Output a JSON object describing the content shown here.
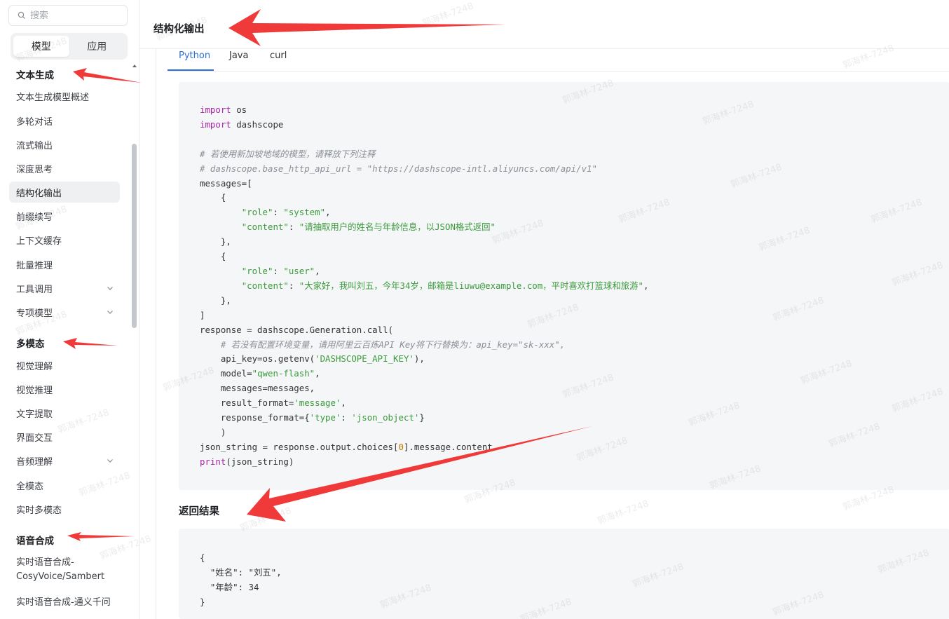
{
  "sidebar": {
    "search_placeholder": "搜索",
    "seg_tabs": [
      "模型",
      "应用"
    ],
    "sections": {
      "text_gen": "文本生成",
      "multimodal": "多模态",
      "speech": "语音合成"
    },
    "items_text": [
      "文本生成模型概述",
      "多轮对话",
      "流式输出",
      "深度思考",
      "结构化输出",
      "前缀续写",
      "上下文缓存",
      "批量推理",
      "工具调用",
      "专项模型"
    ],
    "items_mm": [
      "视觉理解",
      "视觉推理",
      "文字提取",
      "界面交互",
      "音频理解",
      "全模态",
      "实时多模态"
    ],
    "items_speech": [
      "实时语音合成-",
      "CosyVoice/Sambert",
      "实时语音合成-通义千问"
    ]
  },
  "content": {
    "title": "结构化输出",
    "tabs": [
      "Python",
      "Java",
      "curl"
    ],
    "result_title": "返回结果"
  },
  "code": {
    "l1": "import",
    "l1b": " os",
    "l2": "import",
    "l2b": " dashscope",
    "c1": "# 若使用新加坡地域的模型，请释放下列注释",
    "c2": "# dashscope.base_http_api_url = \"https://dashscope-intl.aliyuncs.com/api/v1\"",
    "l5": "messages=[",
    "l6": "    {",
    "l7k": "\"role\"",
    "l7v": "\"system\"",
    "l8k": "\"content\"",
    "l8v": "\"请抽取用户的姓名与年龄信息，以JSON格式返回\"",
    "l9": "    },",
    "l10": "    {",
    "l11k": "\"role\"",
    "l11v": "\"user\"",
    "l12k": "\"content\"",
    "l12v": "\"大家好，我叫刘五，今年34岁，邮箱是liuwu@example.com，平时喜欢打篮球和旅游\"",
    "l13": "    },",
    "l14": "]",
    "l15": "response = dashscope.Generation.call(",
    "c3": "    # 若没有配置环境变量，请用阿里云百炼API Key将下行替换为：api_key=\"sk-xxx\",",
    "l17a": "    api_key=os.getenv(",
    "l17s": "'DASHSCOPE_API_KEY'",
    "l17b": "),",
    "l18a": "    model=",
    "l18s": "\"qwen-flash\"",
    "l18b": ",",
    "l19": "    messages=messages,",
    "l20a": "    result_format=",
    "l20s": "'message'",
    "l20b": ",",
    "l21a": "    response_format={",
    "l21k": "'type'",
    "l21m": ": ",
    "l21v": "'json_object'",
    "l21b": "}",
    "l22": "    )",
    "l23a": "json_string = response.output.choices[",
    "l23n": "0",
    "l23b": "].message.content",
    "l24k": "print",
    "l24b": "(json_string)"
  },
  "result": {
    "r1": "{",
    "r2": "  \"姓名\": \"刘五\",",
    "r3": "  \"年龄\": 34",
    "r4": "}"
  },
  "watermark": "郭海林-7248",
  "colors": {
    "accent": "#2c6fd6",
    "arrow": "#f03a3a"
  }
}
